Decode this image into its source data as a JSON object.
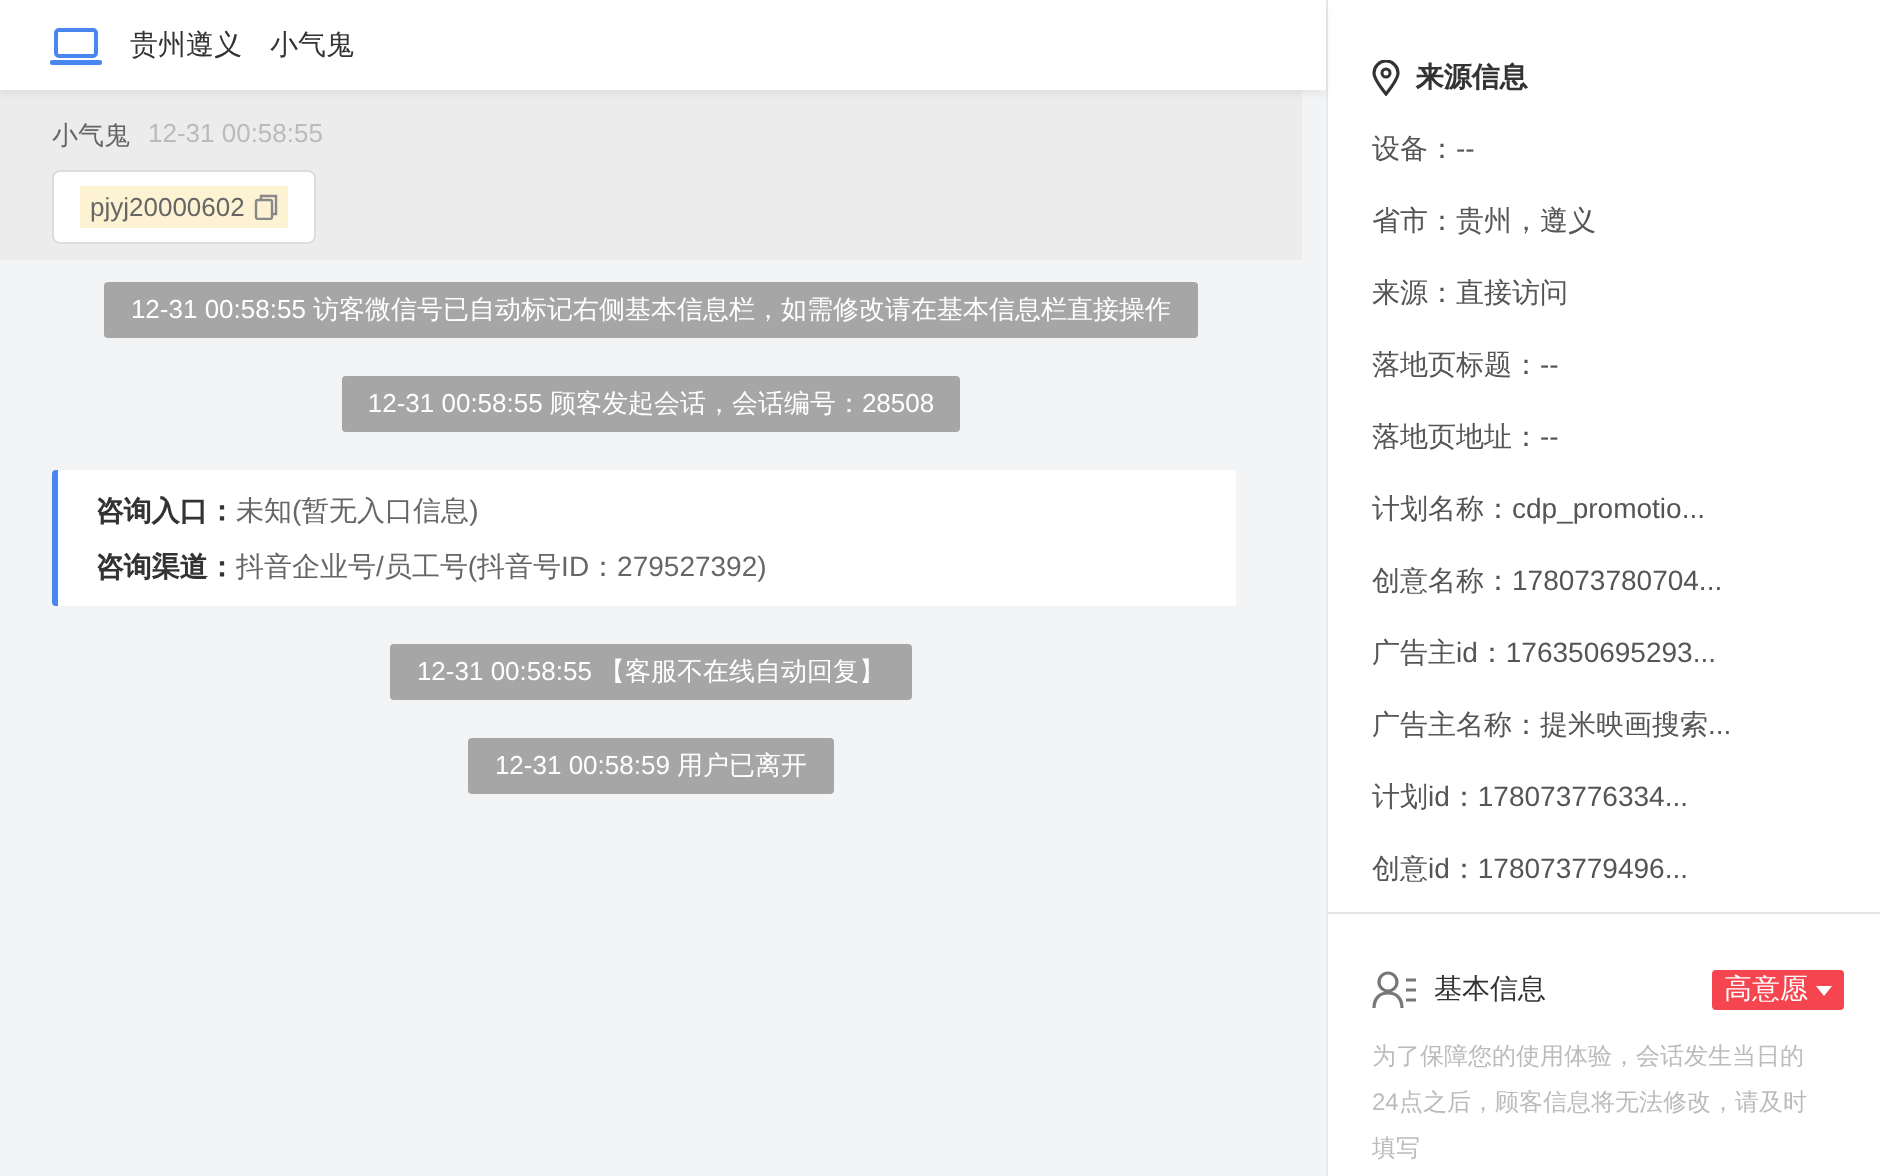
{
  "header": {
    "location": "贵州遵义",
    "visitor": "小气鬼"
  },
  "message": {
    "sender": "小气鬼",
    "time": "12-31 00:58:55",
    "wechat_id": "pjyj20000602"
  },
  "chat": [
    {
      "kind": "notice",
      "text": "12-31 00:58:55 访客微信号已自动标记右侧基本信息栏，如需修改请在基本信息栏直接操作"
    },
    {
      "kind": "notice",
      "text": "12-31 00:58:55 顾客发起会话，会话编号：28508"
    },
    {
      "kind": "entry_card",
      "fields": [
        {
          "label": "咨询入口：",
          "value": "未知(暂无入口信息)"
        },
        {
          "label": "咨询渠道：",
          "value": "抖音企业号/员工号(抖音号ID：279527392)"
        }
      ]
    },
    {
      "kind": "notice",
      "text": "12-31 00:58:55 【客服不在线自动回复】"
    },
    {
      "kind": "notice",
      "text": "12-31 00:58:59 用户已离开"
    }
  ],
  "source_info": {
    "title": "来源信息",
    "items": [
      {
        "text": "设备：--"
      },
      {
        "text": "省市：贵州，遵义"
      },
      {
        "text": "来源：直接访问"
      },
      {
        "text": "落地页标题：--"
      },
      {
        "text": "落地页地址：--"
      },
      {
        "text": "计划名称：cdp_promotio..."
      },
      {
        "text": "创意名称：178073780704..."
      },
      {
        "text": "广告主id：176350695293..."
      },
      {
        "text": "广告主名称：提米映画搜索..."
      },
      {
        "text": "计划id：178073776334..."
      },
      {
        "text": "创意id：178073779496..."
      }
    ]
  },
  "basic_info": {
    "title": "基本信息",
    "intent": "高意愿",
    "notice": "为了保障您的使用体验，会话发生当日的24点之后，顾客信息将无法修改，请及时填写"
  }
}
